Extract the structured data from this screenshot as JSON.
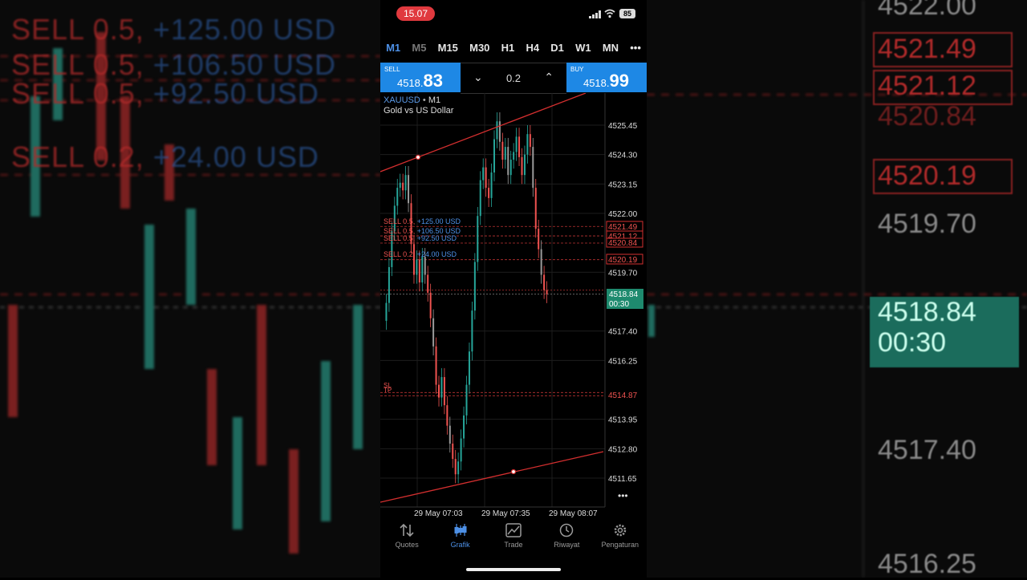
{
  "status_bar": {
    "time": "15.07",
    "battery": "85"
  },
  "timeframes": [
    {
      "label": "M1",
      "state": "active"
    },
    {
      "label": "M5",
      "state": "dim"
    },
    {
      "label": "M15",
      "state": "normal"
    },
    {
      "label": "M30",
      "state": "normal"
    },
    {
      "label": "H1",
      "state": "normal"
    },
    {
      "label": "H4",
      "state": "normal"
    },
    {
      "label": "D1",
      "state": "normal"
    },
    {
      "label": "W1",
      "state": "normal"
    },
    {
      "label": "MN",
      "state": "normal"
    }
  ],
  "trade_bar": {
    "sell_label": "SELL",
    "sell_price_small": "4518.",
    "sell_price_big": "83",
    "lot": "0.2",
    "buy_label": "BUY",
    "buy_price_small": "4518.",
    "buy_price_big": "99"
  },
  "chart": {
    "symbol": "XAUUSD",
    "timeframe": "M1",
    "description": "Gold vs US Dollar",
    "y_ticks": [
      "4525.45",
      "4524.30",
      "4523.15",
      "4522.00",
      "4519.70",
      "4517.40",
      "4516.25",
      "4513.95",
      "4512.80",
      "4511.65"
    ],
    "x_ticks": [
      "29 May 07:03",
      "29 May 07:35",
      "29 May 08:07"
    ],
    "positions": [
      {
        "side": "SELL 0.5,",
        "profit": "+125.00 USD",
        "price": "4521.49"
      },
      {
        "side": "SELL 0.5,",
        "profit": "+106.50 USD",
        "price": "4521.12"
      },
      {
        "side": "SELL 0.5,",
        "profit": "+92.50 USD",
        "price": "4520.84"
      },
      {
        "side": "SELL 0.2,",
        "profit": "+24.00 USD",
        "price": "4520.19"
      }
    ],
    "sl_tp_label": "SL",
    "tp_label": "TP",
    "sl_price": "4514.87",
    "bid_price": "4518.84",
    "countdown": "00:30",
    "colors": {
      "bull": "#26a69a",
      "bear": "#ef5350",
      "trendline": "#d32f2f",
      "accent": "#1e88e5"
    }
  },
  "nav": [
    {
      "label": "Quotes",
      "icon": "quotes-icon"
    },
    {
      "label": "Grafik",
      "icon": "chart-candles-icon",
      "active": true
    },
    {
      "label": "Trade",
      "icon": "trade-icon"
    },
    {
      "label": "Riwayat",
      "icon": "history-icon"
    },
    {
      "label": "Pengaturan",
      "icon": "settings-gear-icon"
    }
  ],
  "background": {
    "left_rows": [
      {
        "side": "SELL 0.5,",
        "profit": "+125.00 USD"
      },
      {
        "side": "SELL 0.5,",
        "profit": "+106.50 USD"
      },
      {
        "side": "SELL 0.5,",
        "profit": "+92.50 USD"
      },
      {
        "side": "SELL 0.2,",
        "profit": "+24.00 USD"
      }
    ],
    "right_prices": [
      "4522.00",
      "4521.49",
      "4521.12",
      "4520.84",
      "4520.19",
      "4519.70",
      "4518.84",
      "00:30",
      "4517.40",
      "4516.25"
    ]
  }
}
